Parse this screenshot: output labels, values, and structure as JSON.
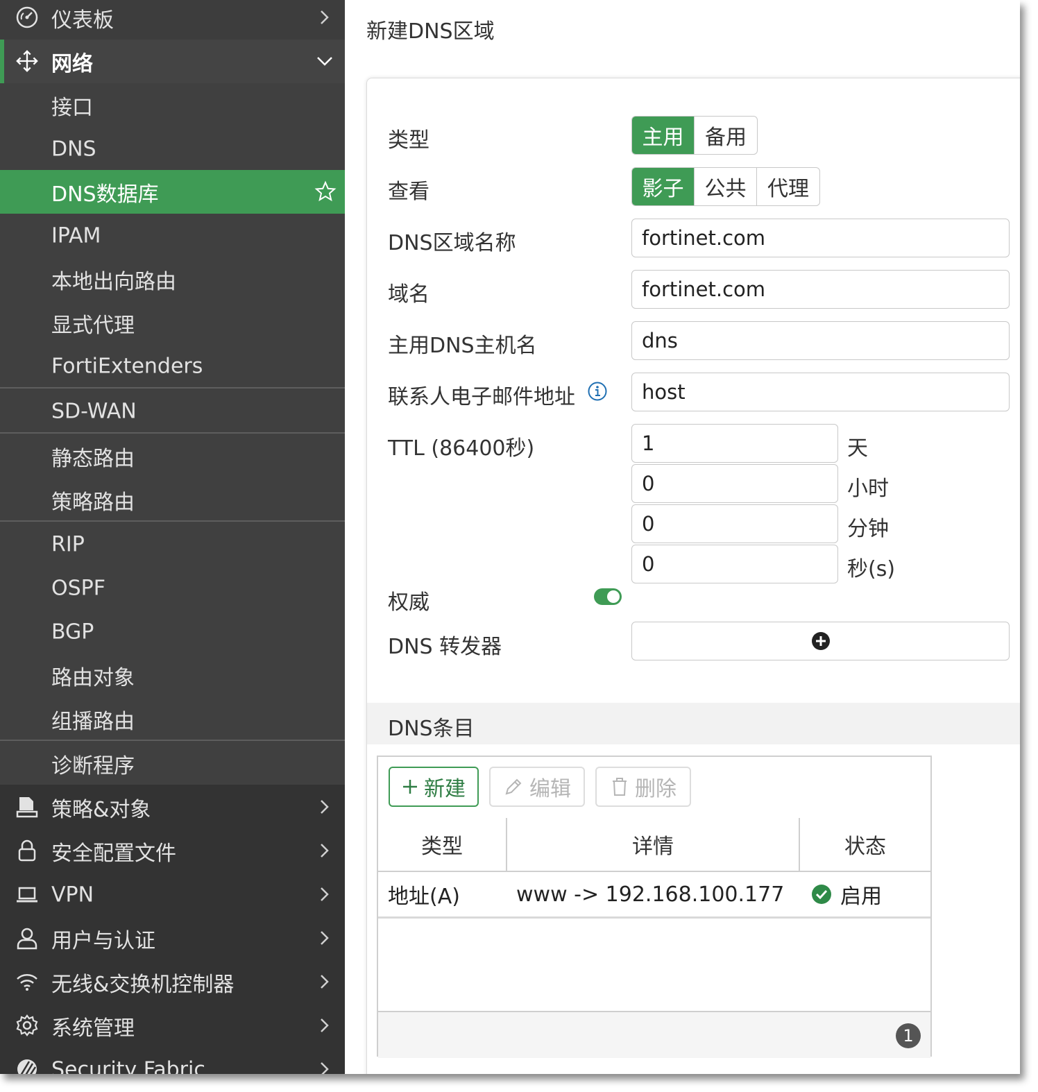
{
  "sidebar": {
    "items": [
      {
        "label": "仪表板",
        "icon": "dashboard-icon"
      },
      {
        "label": "网络",
        "icon": "network-move-icon"
      },
      {
        "label": "接口"
      },
      {
        "label": "DNS"
      },
      {
        "label": "DNS数据库",
        "icon": "star-icon"
      },
      {
        "label": "IPAM"
      },
      {
        "label": "本地出向路由"
      },
      {
        "label": "显式代理"
      },
      {
        "label": "FortiExtenders"
      },
      {
        "label": "SD-WAN"
      },
      {
        "label": "静态路由"
      },
      {
        "label": "策略路由"
      },
      {
        "label": "RIP"
      },
      {
        "label": "OSPF"
      },
      {
        "label": "BGP"
      },
      {
        "label": "路由对象"
      },
      {
        "label": "组播路由"
      },
      {
        "label": "诊断程序"
      },
      {
        "label": "策略&对象",
        "icon": "policy-doc-icon"
      },
      {
        "label": "安全配置文件",
        "icon": "lock-icon"
      },
      {
        "label": "VPN",
        "icon": "laptop-icon"
      },
      {
        "label": "用户与认证",
        "icon": "user-icon"
      },
      {
        "label": "无线&交换机控制器",
        "icon": "wifi-icon"
      },
      {
        "label": "系统管理",
        "icon": "gear-icon"
      },
      {
        "label": "Security Fabric",
        "icon": "fabric-icon"
      }
    ]
  },
  "main": {
    "title": "新建DNS区域",
    "form": {
      "type_label": "类型",
      "type_options": [
        "主用",
        "备用"
      ],
      "view_label": "查看",
      "view_options": [
        "影子",
        "公共",
        "代理"
      ],
      "zone_name_label": "DNS区域名称",
      "zone_name_value": "fortinet.com",
      "domain_label": "域名",
      "domain_value": "fortinet.com",
      "primary_host_label": "主用DNS主机名",
      "primary_host_value": "dns",
      "email_label": "联系人电子邮件地址",
      "email_value": "host",
      "ttl_label": "TTL (86400秒)",
      "ttl_days": "1",
      "ttl_days_unit": "天",
      "ttl_hours": "0",
      "ttl_hours_unit": "小时",
      "ttl_minutes": "0",
      "ttl_minutes_unit": "分钟",
      "ttl_seconds": "0",
      "ttl_seconds_unit": "秒(s)",
      "authoritative_label": "权威",
      "authoritative_on": true,
      "forwarder_label": "DNS 转发器"
    },
    "entries": {
      "section_title": "DNS条目",
      "toolbar": {
        "new": "新建",
        "edit": "编辑",
        "delete": "删除"
      },
      "columns": [
        "类型",
        "详情",
        "状态"
      ],
      "rows": [
        {
          "type": "地址(A)",
          "detail": "www -> 192.168.100.177",
          "status": "启用"
        }
      ],
      "count": "1"
    }
  },
  "colors": {
    "accent": "#3f9b55",
    "sidebar_bg": "#333333"
  }
}
